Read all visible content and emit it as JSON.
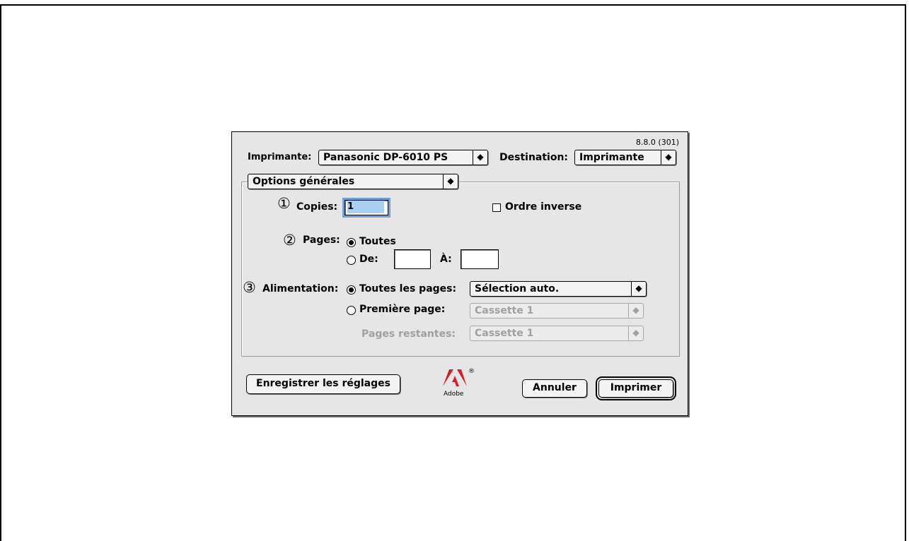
{
  "version": "8.8.0 (301)",
  "printer": {
    "label": "Imprimante:",
    "value": "Panasonic DP-6010 PS"
  },
  "destination": {
    "label": "Destination:",
    "value": "Imprimante"
  },
  "panel_menu": {
    "value": "Options générales"
  },
  "annotations": {
    "one": "①",
    "two": "②",
    "three": "③"
  },
  "copies": {
    "label": "Copies:",
    "value": "1"
  },
  "reverse_order": {
    "label": "Ordre inverse",
    "checked": false
  },
  "pages": {
    "label": "Pages:",
    "all_label": "Toutes",
    "from_label": "De:",
    "to_label": "À:",
    "from_value": "",
    "to_value": "",
    "selected": "all"
  },
  "paper_source": {
    "label": "Alimentation:",
    "all_pages_label": "Toutes les pages:",
    "all_pages_value": "Sélection auto.",
    "first_page_label": "Première page:",
    "first_page_value": "Cassette 1",
    "remaining_label": "Pages restantes:",
    "remaining_value": "Cassette 1",
    "selected": "all_pages"
  },
  "buttons": {
    "save_settings": "Enregistrer les réglages",
    "cancel": "Annuler",
    "print": "Imprimer"
  },
  "logo": {
    "text": "Adobe",
    "mark": "®"
  },
  "colors": {
    "focus_ring": "#6fa0d8",
    "selection": "#a9d0f2",
    "dialog_bg": "#e6e6e6",
    "disabled": "#a0a0a0"
  }
}
